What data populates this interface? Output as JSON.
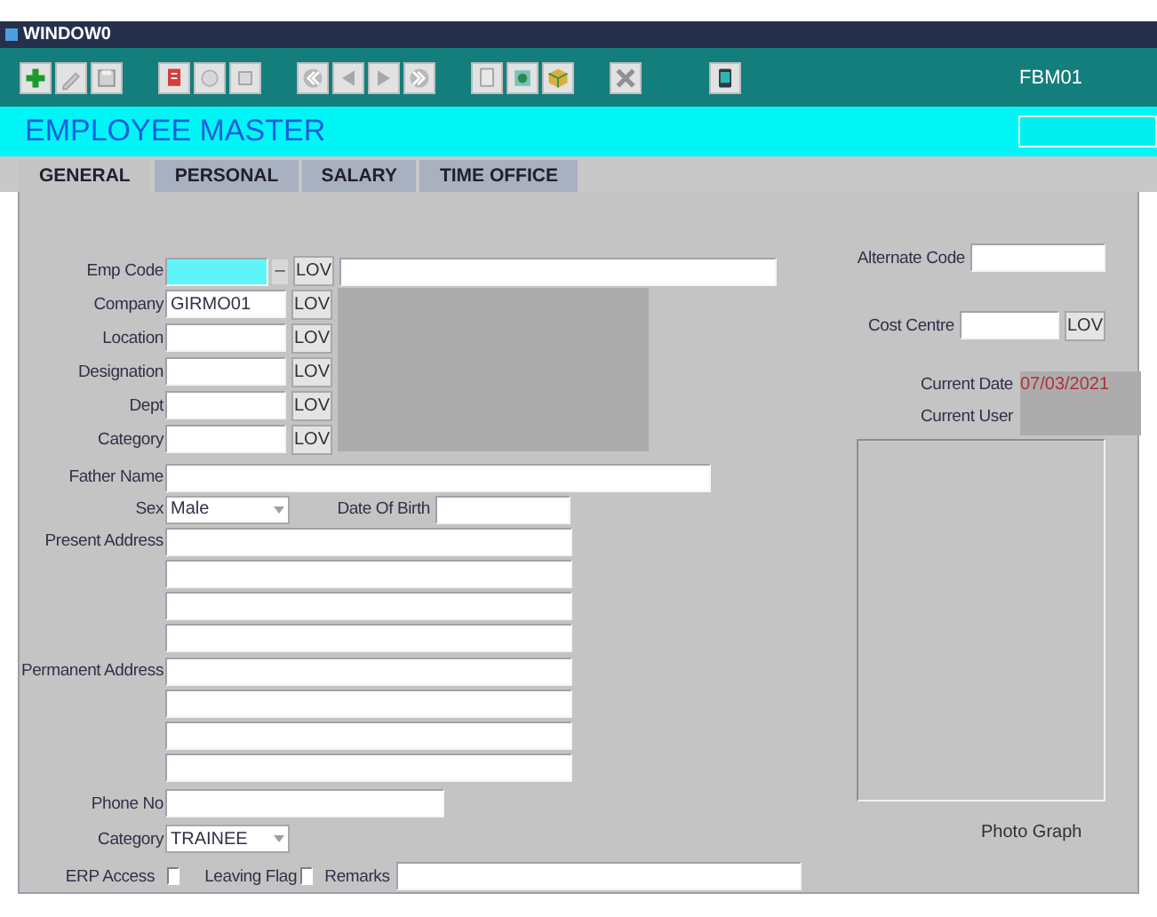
{
  "window": {
    "title": "WINDOW0"
  },
  "toolbar": {
    "form_code": "FBM01"
  },
  "header": {
    "title": "EMPLOYEE MASTER"
  },
  "tabs": [
    {
      "label": "GENERAL",
      "selected": true
    },
    {
      "label": "PERSONAL",
      "selected": false
    },
    {
      "label": "SALARY",
      "selected": false
    },
    {
      "label": "TIME OFFICE",
      "selected": false
    }
  ],
  "emp_code": {
    "label": "Emp Code",
    "focused": true,
    "separator": "–",
    "lov": "LOV"
  },
  "lov_rows": [
    {
      "label": "Company",
      "value": "GIRMO01",
      "lov": "LOV"
    },
    {
      "label": "Location",
      "lov": "LOV"
    },
    {
      "label": "Designation",
      "lov": "LOV"
    },
    {
      "label": "Dept",
      "lov": "LOV"
    },
    {
      "label": "Category",
      "lov": "LOV"
    }
  ],
  "father_name": {
    "label": "Father Name"
  },
  "sex": {
    "label": "Sex",
    "value": "Male"
  },
  "date_of_birth": {
    "label": "Date Of Birth"
  },
  "present_address": {
    "label": "Present Address"
  },
  "permanent_address": {
    "label": "Permanent Address"
  },
  "phone_no": {
    "label": "Phone No"
  },
  "category": {
    "label": "Category",
    "value": "TRAINEE"
  },
  "erp_access": {
    "label": "ERP Access",
    "checked": false
  },
  "leaving_flag": {
    "label": "Leaving Flag",
    "checked": false
  },
  "remarks": {
    "label": "Remarks"
  },
  "alternate_code": {
    "label": "Alternate Code"
  },
  "cost_centre": {
    "label": "Cost Centre",
    "lov": "LOV"
  },
  "current_date": {
    "label": "Current Date",
    "value": "07/03/2021"
  },
  "current_user": {
    "label": "Current User"
  },
  "photo": {
    "caption": "Photo Graph"
  }
}
